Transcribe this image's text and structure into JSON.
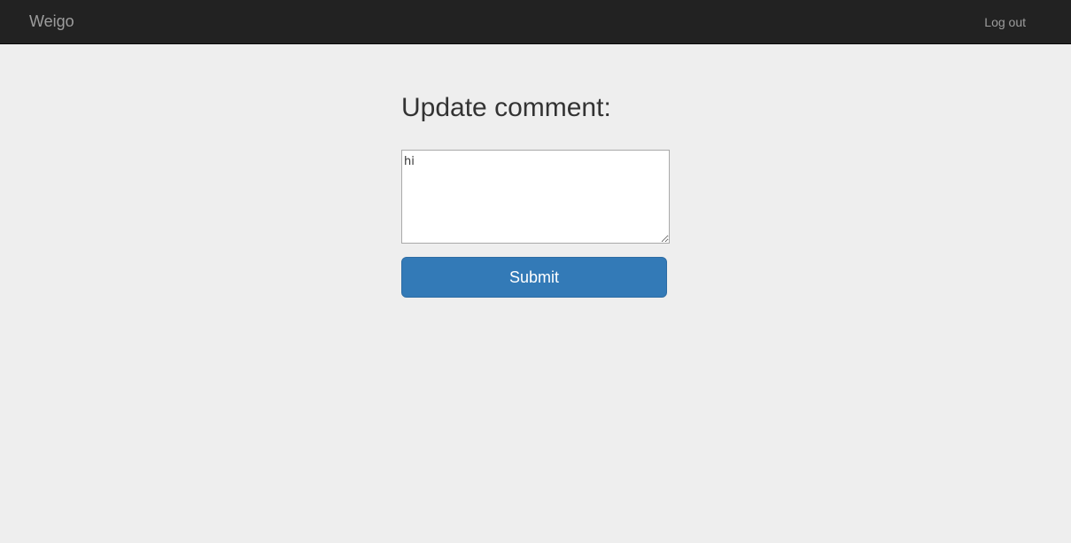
{
  "navbar": {
    "brand": "Weigo",
    "logout_label": "Log out",
    "background_color": "#222222",
    "link_color": "#9d9d9d"
  },
  "main": {
    "title": "Update comment:",
    "comment": {
      "value": "hi",
      "placeholder": ""
    },
    "submit_label": "Submit",
    "accent_color": "#337ab7",
    "background_color": "#eeeeee"
  }
}
